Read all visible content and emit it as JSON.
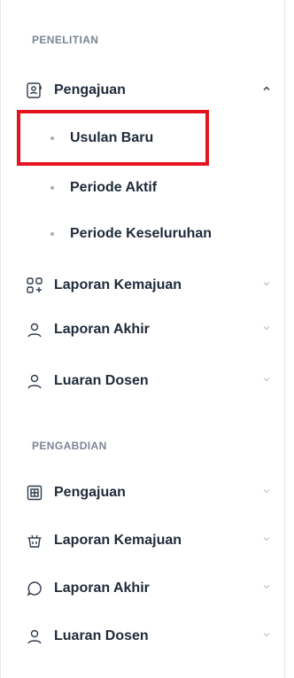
{
  "sections": [
    {
      "title": "PENELITIAN",
      "items": [
        {
          "label": "Pengajuan",
          "icon": "user-card-icon",
          "open": true,
          "children": [
            "Usulan Baru",
            "Periode Aktif",
            "Periode Keseluruhan"
          ]
        },
        {
          "label": "Laporan Kemajuan",
          "icon": "grid-plus-icon"
        },
        {
          "label": "Laporan Akhir",
          "icon": "user-icon"
        },
        {
          "label": "Luaran Dosen",
          "icon": "user-icon"
        }
      ]
    },
    {
      "title": "PENGABDIAN",
      "items": [
        {
          "label": "Pengajuan",
          "icon": "building-icon"
        },
        {
          "label": "Laporan Kemajuan",
          "icon": "basket-icon"
        },
        {
          "label": "Laporan Akhir",
          "icon": "chat-bubble-icon"
        },
        {
          "label": "Luaran Dosen",
          "icon": "user-icon"
        }
      ]
    }
  ],
  "highlighted_item": "Usulan Baru",
  "colors": {
    "highlight_border": "#e3141f",
    "section_title": "#7b8595",
    "chevron": "#c4cad3"
  }
}
